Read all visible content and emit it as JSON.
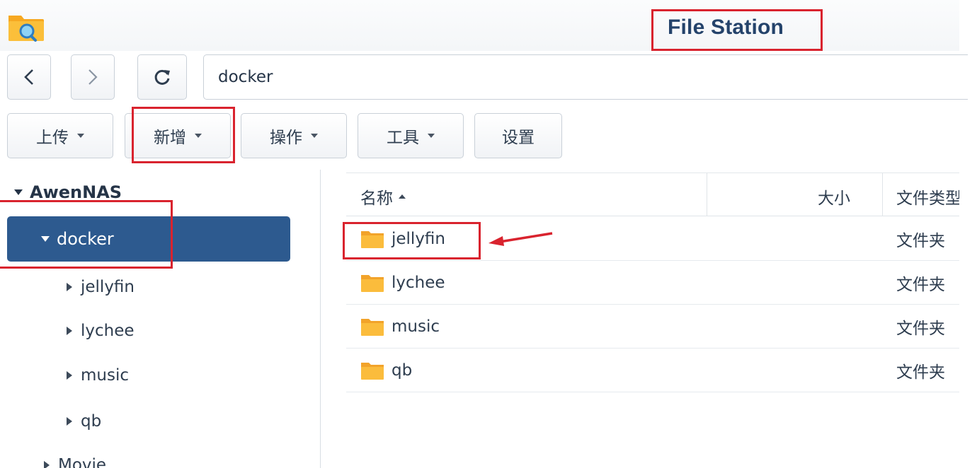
{
  "window": {
    "title": "File Station"
  },
  "nav": {
    "back_icon": "chevron-left-icon",
    "forward_icon": "chevron-right-icon",
    "refresh_icon": "refresh-icon",
    "path": "docker"
  },
  "toolbar": {
    "upload": "上传",
    "create": "新增",
    "action": "操作",
    "tools": "工具",
    "settings": "设置"
  },
  "tree": {
    "root": "AwenNAS",
    "selected": "docker",
    "children": [
      "jellyfin",
      "lychee",
      "music",
      "qb"
    ],
    "next_sibling": "Movie"
  },
  "list": {
    "columns": {
      "name": "名称",
      "size": "大小",
      "type": "文件类型"
    },
    "rows": [
      {
        "name": "jellyfin",
        "type": "文件夹"
      },
      {
        "name": "lychee",
        "type": "文件夹"
      },
      {
        "name": "music",
        "type": "文件夹"
      },
      {
        "name": "qb",
        "type": "文件夹"
      }
    ]
  },
  "colors": {
    "selection": "#2d5a8f",
    "title": "#24436b",
    "annotation": "#d9232e",
    "folder": "#f5a623"
  }
}
